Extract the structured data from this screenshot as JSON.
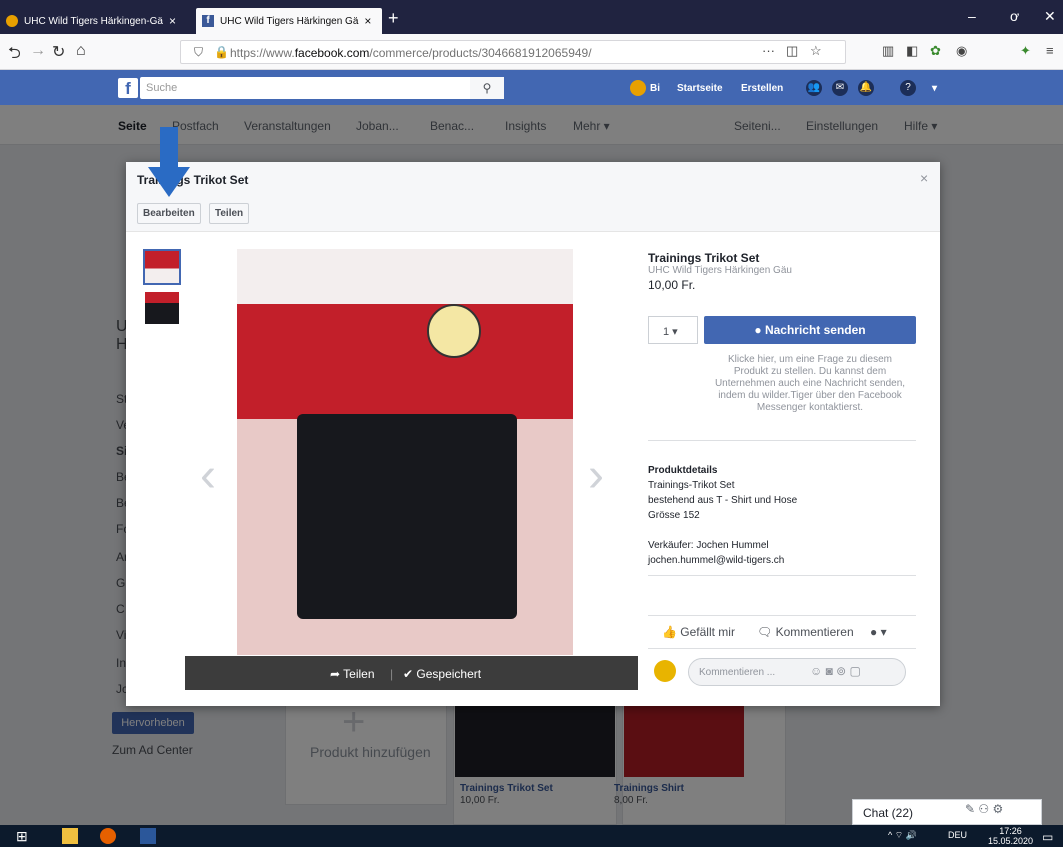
{
  "browser": {
    "tabs": [
      {
        "label": "UHC Wild Tigers Härkingen-Gä",
        "active": false
      },
      {
        "label": "UHC Wild Tigers Härkingen Gä",
        "active": true
      }
    ],
    "new_tab": "+",
    "url_prefix": "https://www.",
    "url_domain": "facebook.com",
    "url_path": "/commerce/products/3046681912065949/",
    "window_controls": [
      "–",
      "ơ",
      "✕"
    ]
  },
  "fb_header": {
    "logo": "f",
    "search_placeholder": "Suche",
    "user": "Bi",
    "home": "Startseite",
    "create": "Erstellen"
  },
  "page_tabs": {
    "seite": "Seite",
    "postfach": "Postfach",
    "veranstaltungen": "Veranstaltungen",
    "jobs": "Joban...",
    "benachrichtigungen": "Benac...",
    "insights": "Insights",
    "mehr": "Mehr ▾",
    "seiteninfo": "Seiteni...",
    "einstellungen": "Einstellungen",
    "hilfe": "Hilfe ▾"
  },
  "left_nav": {
    "letters": [
      "U",
      "H",
      "St",
      "Ve",
      "Si",
      "Be",
      "Be",
      "Fc",
      "Ar",
      "G",
      "C",
      "Vi",
      "In",
      "Jc"
    ],
    "promote": "Hervorheben",
    "ad_center": "Zum Ad Center"
  },
  "background_shop": {
    "add_product": "Produkt hinzufügen",
    "items": [
      {
        "name": "Trainings Trikot Set",
        "price": "10,00 Fr."
      },
      {
        "name": "Trainings Shirt",
        "price": "8,00 Fr."
      }
    ],
    "chat": "Chat (22)"
  },
  "modal": {
    "title": "Trainings Trikot Set",
    "edit_button": "Bearbeiten",
    "share_button": "Teilen",
    "close": "×",
    "photo_bar": {
      "share": "Teilen",
      "saved": "Gespeichert"
    },
    "product": {
      "title": "Trainings Trikot Set",
      "seller": "UHC Wild Tigers Härkingen Gäu",
      "price": "10,00 Fr.",
      "quantity": "1 ▾",
      "message_button": "Nachricht senden",
      "help_text": "Klicke hier, um eine Frage zu diesem Produkt zu stellen. Du kannst dem Unternehmen auch eine Nachricht senden, indem du wilder.Tiger über den Facebook Messenger kontaktierst.",
      "details_heading": "Produktdetails",
      "details_lines": [
        "Trainings-Trikot Set",
        "bestehend aus T - Shirt und Hose",
        "Grösse 152"
      ],
      "seller_line": "Verkäufer: Jochen Hummel",
      "email": "jochen.hummel@wild-tigers.ch",
      "like": "Gefällt mir",
      "comment": "Kommentieren",
      "comment_placeholder": "Kommentieren ..."
    }
  },
  "taskbar": {
    "language": "DEU",
    "time": "17:26",
    "date": "15.05.2020"
  }
}
